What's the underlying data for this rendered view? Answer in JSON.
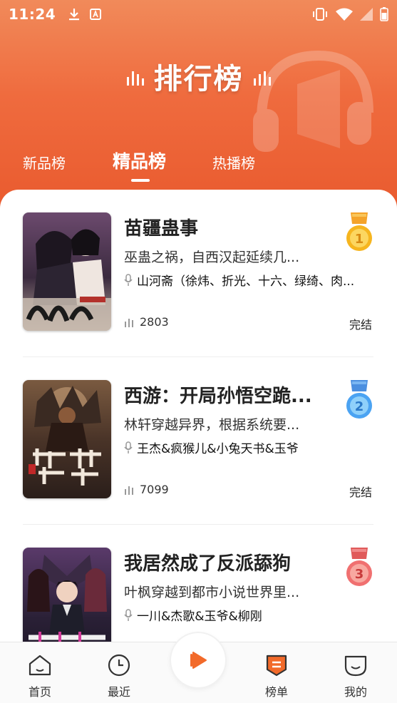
{
  "status": {
    "time": "11:24"
  },
  "header": {
    "title": "排行榜",
    "tabs": [
      {
        "label": "新品榜"
      },
      {
        "label": "精品榜",
        "active": true
      },
      {
        "label": "热播榜"
      }
    ]
  },
  "books": [
    {
      "title": "苗疆蛊事",
      "desc": "巫蛊之祸，自西汉起延续几...",
      "authors": "山河斋（徐炜、折光、十六、绿绮、肉...",
      "plays": "2803",
      "status": "完结",
      "rank": "1"
    },
    {
      "title": "西游：开局孙悟空跪...",
      "desc": "林轩穿越异界，根据系统要...",
      "authors": "王杰&疯猴儿&小兔天书&玉爷",
      "plays": "7099",
      "status": "完结",
      "rank": "2"
    },
    {
      "title": "我居然成了反派舔狗",
      "desc": "叶枫穿越到都市小说世界里...",
      "authors": "一川&杰歌&玉爷&柳刚",
      "rank": "3"
    }
  ],
  "nav": {
    "items": [
      {
        "label": "首页",
        "icon": "home-icon"
      },
      {
        "label": "最近",
        "icon": "clock-icon"
      },
      {
        "label": "榜单",
        "icon": "ranking-icon"
      },
      {
        "label": "我的",
        "icon": "profile-icon"
      }
    ]
  },
  "colors": {
    "header_top": "#f18a5a",
    "header_bottom": "#e95a2e",
    "accent": "#f26a2a",
    "gold": "#f6b51f",
    "silver_blue": "#4ba3f2",
    "bronze_red": "#f07070"
  }
}
